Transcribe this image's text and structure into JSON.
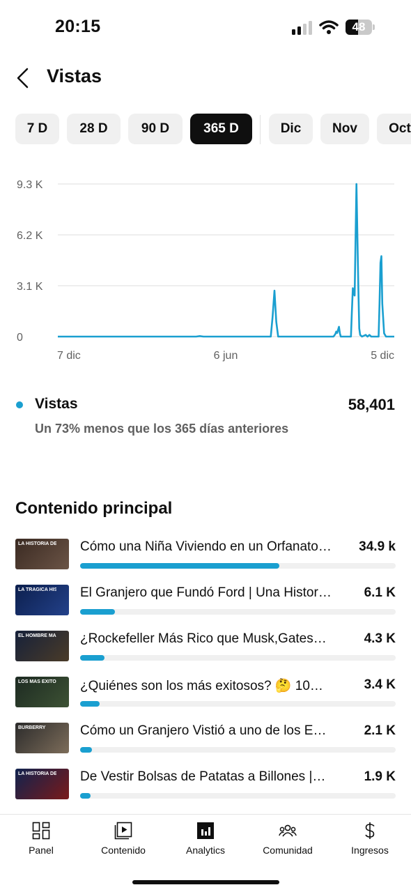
{
  "status_bar": {
    "time": "20:15",
    "battery": "48",
    "battery_fraction": 0.48
  },
  "header": {
    "title": "Vistas"
  },
  "periods": [
    {
      "label": "7 D",
      "active": false
    },
    {
      "label": "28 D",
      "active": false
    },
    {
      "label": "90 D",
      "active": false
    },
    {
      "label": "365 D",
      "active": true
    },
    {
      "label": "Dic",
      "active": false
    },
    {
      "label": "Nov",
      "active": false
    },
    {
      "label": "Oct",
      "active": false
    }
  ],
  "chart_data": {
    "type": "line",
    "series": [
      {
        "color": "#1a9fd0",
        "values": [
          [
            0,
            0
          ],
          [
            150,
            0
          ],
          [
            154,
            30
          ],
          [
            158,
            0
          ],
          [
            231,
            0
          ],
          [
            233,
            1200
          ],
          [
            235,
            2800
          ],
          [
            237,
            900
          ],
          [
            239,
            0
          ],
          [
            299,
            0
          ],
          [
            301,
            150
          ],
          [
            302,
            300
          ],
          [
            303,
            220
          ],
          [
            305,
            600
          ],
          [
            306,
            200
          ],
          [
            307,
            0
          ],
          [
            318,
            0
          ],
          [
            319,
            1500
          ],
          [
            320,
            2950
          ],
          [
            321,
            2600
          ],
          [
            322,
            2500
          ],
          [
            324,
            9300
          ],
          [
            326,
            3000
          ],
          [
            327,
            500
          ],
          [
            328,
            100
          ],
          [
            330,
            0
          ],
          [
            334,
            100
          ],
          [
            336,
            0
          ],
          [
            338,
            100
          ],
          [
            340,
            0
          ],
          [
            348,
            0
          ],
          [
            349,
            2000
          ],
          [
            350,
            4500
          ],
          [
            351,
            4900
          ],
          [
            352,
            2000
          ],
          [
            354,
            200
          ],
          [
            356,
            0
          ],
          [
            365,
            0
          ]
        ]
      }
    ],
    "x_ticks": [
      "7 dic",
      "6 jun",
      "5 dic"
    ],
    "y_ticks": [
      "0",
      "3.1 K",
      "6.2 K",
      "9.3 K"
    ],
    "y_tick_values": [
      0,
      3100,
      6200,
      9300
    ],
    "xlim": [
      0,
      365
    ],
    "ylim": [
      0,
      9300
    ],
    "grid": true
  },
  "metric": {
    "label": "Vistas",
    "value": "58,401",
    "comparison": "Un 73% menos que los 365 días anteriores",
    "color": "#1a9fd0"
  },
  "top_content": {
    "title": "Contenido principal",
    "items": [
      {
        "title": "Cómo una Niña Viviendo en un Orfanato…",
        "value": "34.9 k",
        "fraction": 0.632,
        "thumb_caption": "LA HISTORIA DE CHANEL",
        "thumb_colors": [
          "#3a2a22",
          "#6b5446"
        ]
      },
      {
        "title": "El Granjero que Fundó Ford | Una Historia…",
        "value": "6.1 K",
        "fraction": 0.11,
        "thumb_caption": "LA TRÁGICA HISTORIA DE FORD",
        "thumb_colors": [
          "#0c1f4d",
          "#23418a"
        ]
      },
      {
        "title": "¿Rockefeller Más Rico que Musk,Gates…",
        "value": "4.3 K",
        "fraction": 0.078,
        "thumb_caption": "EL HOMBRE MÁS RICO DE LA HISTORIA",
        "thumb_colors": [
          "#16213a",
          "#4a3b28"
        ]
      },
      {
        "title": "¿Quiénes son los más exitosos? 🤔 10…",
        "value": "3.4 K",
        "fraction": 0.062,
        "thumb_caption": "LOS MÁS EXITOSOS DE LA HISTORIA",
        "thumb_colors": [
          "#1d2a22",
          "#3d5234"
        ]
      },
      {
        "title": "Cómo un Granjero Vistió a uno de los E…",
        "value": "2.1 K",
        "fraction": 0.038,
        "thumb_caption": "BURBERRY",
        "thumb_colors": [
          "#2b2b2b",
          "#7d6d5a"
        ]
      },
      {
        "title": "De Vestir Bolsas de Patatas a Billones |…",
        "value": "1.9 K",
        "fraction": 0.034,
        "thumb_caption": "LA HISTORIA DE OPRAH",
        "thumb_colors": [
          "#10234f",
          "#7a1a1a"
        ]
      }
    ]
  },
  "bottom_nav": [
    {
      "label": "Panel",
      "icon": "dashboard-icon"
    },
    {
      "label": "Contenido",
      "icon": "content-icon"
    },
    {
      "label": "Analytics",
      "icon": "analytics-icon",
      "active": true
    },
    {
      "label": "Comunidad",
      "icon": "community-icon"
    },
    {
      "label": "Ingresos",
      "icon": "dollar-icon"
    }
  ]
}
